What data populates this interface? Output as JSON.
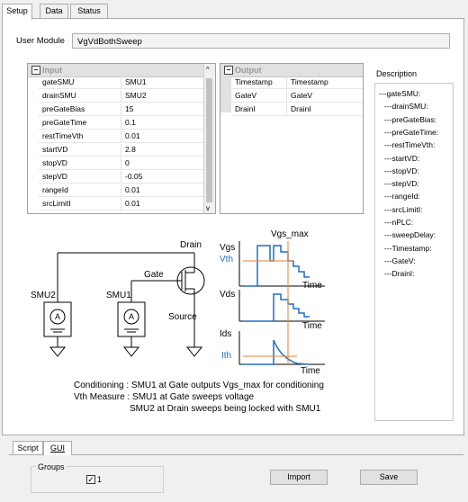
{
  "tabs_top": [
    "Setup",
    "Data",
    "Status"
  ],
  "module": {
    "label": "User Module",
    "value": "VgVdBothSweep"
  },
  "input_grid": {
    "header": "Input",
    "rows": [
      {
        "k": "gateSMU",
        "v": "SMU1"
      },
      {
        "k": "drainSMU",
        "v": "SMU2"
      },
      {
        "k": "preGateBias",
        "v": "15"
      },
      {
        "k": "preGateTime",
        "v": "0.1"
      },
      {
        "k": "restTimeVth",
        "v": "0.01"
      },
      {
        "k": "startVD",
        "v": "2.8"
      },
      {
        "k": "stopVD",
        "v": "0"
      },
      {
        "k": "stepVD",
        "v": "-0.05"
      },
      {
        "k": "rangeId",
        "v": "0.01"
      },
      {
        "k": "srcLimitI",
        "v": "0.01"
      }
    ]
  },
  "output_grid": {
    "header": "Output",
    "rows": [
      {
        "k": "Timestamp",
        "v": "Timestamp"
      },
      {
        "k": "GateV",
        "v": "GateV"
      },
      {
        "k": "DrainI",
        "v": "DrainI"
      }
    ]
  },
  "description": {
    "title": "Description",
    "items": [
      "---gateSMU:",
      "---drainSMU:",
      "---preGateBias:",
      "---preGateTime:",
      "---restTimeVth:",
      "---startVD:",
      "---stopVD:",
      "---stepVD:",
      "---rangeId:",
      "---srcLimitI:",
      "---nPLC:",
      "---sweepDelay:",
      "---Timestamp:",
      "---GateV:",
      "---DrainI:"
    ]
  },
  "diagram": {
    "drain": "Drain",
    "gate": "Gate",
    "source": "Source",
    "smu1": "SMU1",
    "smu2": "SMU2",
    "meter_symbol": "A",
    "vgs_max": "Vgs_max",
    "vgs": "Vgs",
    "vth": "Vth",
    "vds": "Vds",
    "ids": "Ids",
    "ith": "Ith",
    "time": "Time",
    "line1": "Conditioning : SMU1 at Gate outputs Vgs_max for conditioning",
    "line2": "Vth Measure : SMU1 at Gate sweeps voltage",
    "line3": "SMU2 at Drain sweeps being locked with SMU1"
  },
  "bottom_tabs": [
    "Script",
    "GUI"
  ],
  "groups": {
    "label": "Groups",
    "item": "1",
    "checked": true
  },
  "buttons": {
    "import": "Import",
    "save": "Save"
  },
  "colors": {
    "blue": "#1f6fc5",
    "orange": "#e8823a",
    "accent_text": "#1f6fc5"
  }
}
